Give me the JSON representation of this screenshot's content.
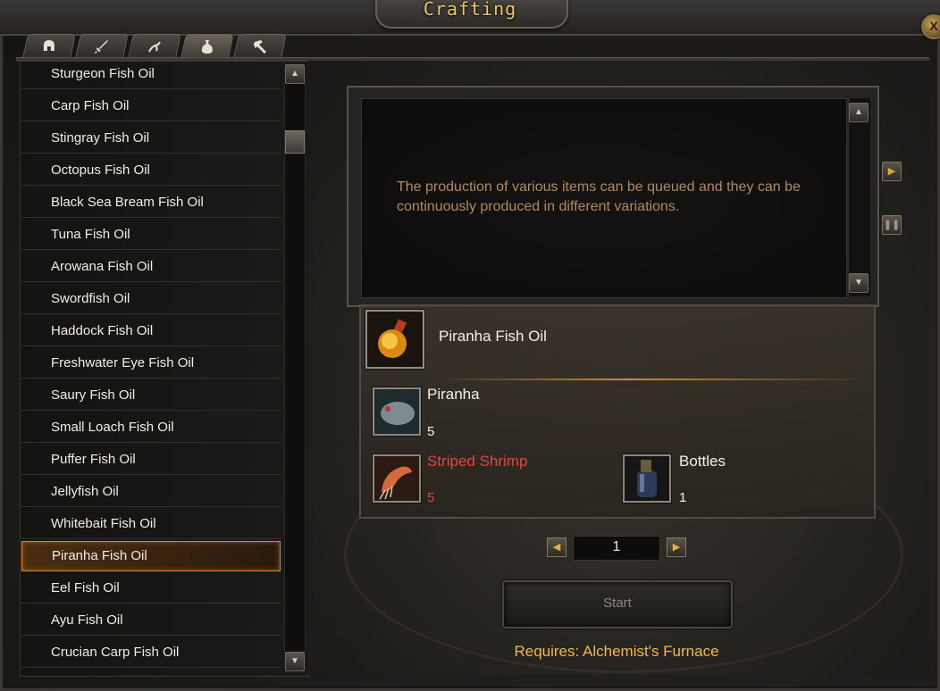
{
  "window": {
    "title": "Crafting",
    "close_label": "X"
  },
  "tabs": [
    {
      "icon": "helmet-icon",
      "active": false
    },
    {
      "icon": "sword-icon",
      "active": false
    },
    {
      "icon": "rope-icon",
      "active": false
    },
    {
      "icon": "potion-bag-icon",
      "active": true
    },
    {
      "icon": "hammer-icon",
      "active": false
    }
  ],
  "recipe_list": {
    "items": [
      "Sturgeon Fish Oil",
      "Carp Fish Oil",
      "Stingray Fish Oil",
      "Octopus Fish Oil",
      "Black Sea Bream Fish Oil",
      "Tuna Fish Oil",
      "Arowana Fish Oil",
      "Swordfish Oil",
      "Haddock Fish Oil",
      "Freshwater Eye Fish Oil",
      "Saury Fish Oil",
      "Small Loach Fish Oil",
      "Puffer Fish Oil",
      "Jellyfish Oil",
      "Whitebait Fish Oil",
      "Piranha Fish Oil",
      "Eel Fish Oil",
      "Ayu Fish Oil",
      "Crucian Carp Fish Oil"
    ],
    "selected_index": 15
  },
  "description": {
    "text": "The production of various items can be queued and they can be continuously produced in different variations."
  },
  "recipe": {
    "product": {
      "name": "Piranha Fish Oil",
      "icon": "fish-oil-potion-icon"
    },
    "ingredients": [
      {
        "name": "Piranha",
        "count": "5",
        "icon": "piranha-icon",
        "insufficient": false
      },
      {
        "name": "Striped Shrimp",
        "count": "5",
        "icon": "shrimp-icon",
        "insufficient": true
      },
      {
        "name": "Bottles",
        "count": "1",
        "icon": "bottle-icon",
        "insufficient": false
      }
    ]
  },
  "quantity": {
    "value": "1"
  },
  "actions": {
    "start_label": "Start"
  },
  "requirement": {
    "text": "Requires: Alchemist's Furnace"
  },
  "colors": {
    "accent": "#f2b848",
    "insufficient": "#e5443f",
    "selection_border": "#d98a2a"
  }
}
